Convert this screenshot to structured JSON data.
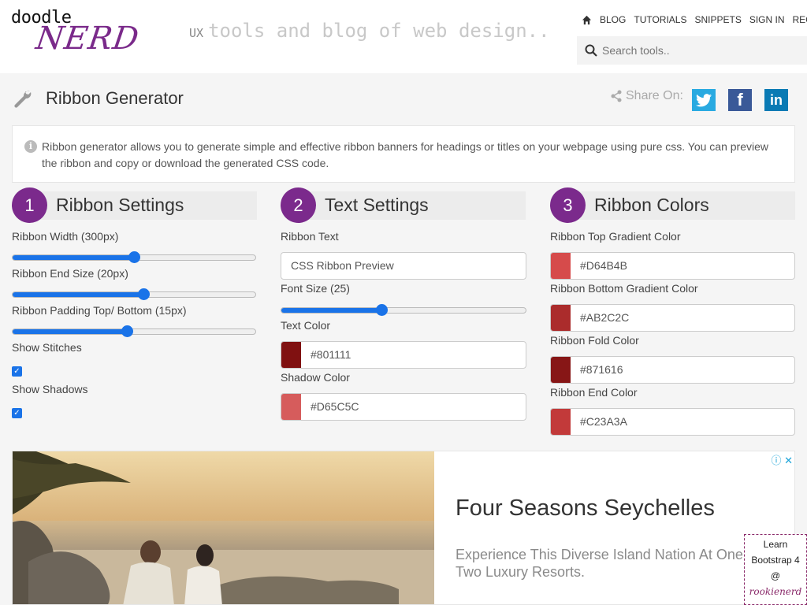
{
  "header": {
    "logo_top": "doodle",
    "logo_bottom": "NERD",
    "tagline_prefix": "UX",
    "tagline": "tools and blog of web design..",
    "nav": [
      "BLOG",
      "TUTORIALS",
      "SNIPPETS",
      "SIGN IN",
      "REGISTER"
    ],
    "search_placeholder": "Search tools.."
  },
  "page": {
    "title": "Ribbon Generator",
    "share_label": "Share On:",
    "social": [
      {
        "name": "twitter",
        "glyph": "t"
      },
      {
        "name": "facebook",
        "glyph": "f"
      },
      {
        "name": "linkedin",
        "glyph": "in"
      }
    ],
    "info_text": "Ribbon generator allows you to generate simple and effective ribbon banners for headings or titles on your webpage using pure css. You can preview the ribbon and copy or download the generated CSS code."
  },
  "ribbon_settings": {
    "num": "1",
    "heading": "Ribbon Settings",
    "width_label": "Ribbon Width (300px)",
    "width_value": 0.5,
    "end_size_label": "Ribbon End Size (20px)",
    "end_size_value": 0.54,
    "padding_label": "Ribbon Padding Top/ Bottom (15px)",
    "padding_value": 0.47,
    "stitches_label": "Show Stitches",
    "stitches_checked": true,
    "shadows_label": "Show Shadows",
    "shadows_checked": true
  },
  "text_settings": {
    "num": "2",
    "heading": "Text Settings",
    "text_label": "Ribbon Text",
    "text_value": "CSS Ribbon Preview",
    "font_size_label": "Font Size (25)",
    "font_size_value": 0.41,
    "text_color_label": "Text Color",
    "text_color": "#801111",
    "shadow_color_label": "Shadow Color",
    "shadow_color": "#D65C5C"
  },
  "ribbon_colors": {
    "num": "3",
    "heading": "Ribbon Colors",
    "top_label": "Ribbon Top Gradient Color",
    "top_color": "#D64B4B",
    "bottom_label": "Ribbon Bottom Gradient Color",
    "bottom_color": "#AB2C2C",
    "fold_label": "Ribbon Fold Color",
    "fold_color": "#871616",
    "end_label": "Ribbon End Color",
    "end_color": "#C23A3A"
  },
  "ad": {
    "headline": "Four Seasons Seychelles",
    "description": "Experience This Diverse Island Nation At One Of Two Luxury Resorts."
  },
  "promo": {
    "line1": "Learn",
    "line2": "Bootstrap 4",
    "line3": "@",
    "brand": "rookienerd"
  },
  "colors": {
    "accent": "#7b2a8c",
    "slider": "#1a73e8"
  }
}
